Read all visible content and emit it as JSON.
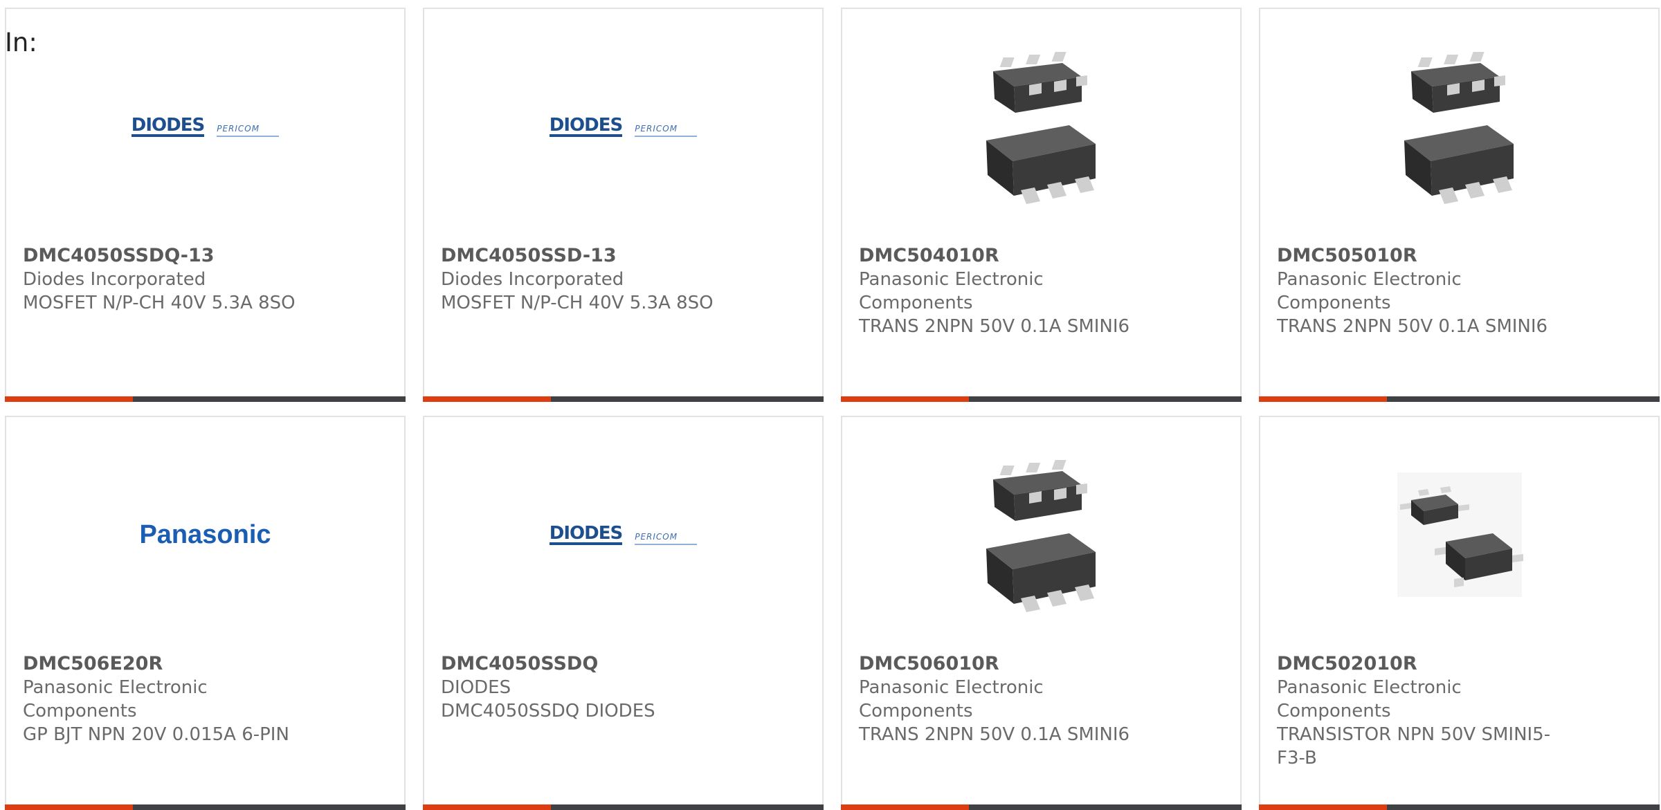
{
  "header": {
    "label": "In:"
  },
  "products": [
    {
      "part_number": "DMC4050SSDQ-13",
      "manufacturer": "Diodes Incorporated",
      "description": "MOSFET N/P-CH 40V 5.3A 8SO",
      "image": "diodes-pericom-logo"
    },
    {
      "part_number": "DMC4050SSD-13",
      "manufacturer": "Diodes Incorporated",
      "description": "MOSFET N/P-CH 40V 5.3A 8SO",
      "image": "diodes-pericom-logo"
    },
    {
      "part_number": "DMC504010R",
      "manufacturer": "Panasonic Electronic Components",
      "description": "TRANS 2NPN 50V 0.1A SMINI6",
      "image": "smini6-package"
    },
    {
      "part_number": "DMC505010R",
      "manufacturer": "Panasonic Electronic Components",
      "description": "TRANS 2NPN 50V 0.1A SMINI6",
      "image": "smini6-package"
    },
    {
      "part_number": "DMC506E20R",
      "manufacturer": "Panasonic Electronic Components",
      "description": "GP BJT NPN 20V 0.015A 6-PIN",
      "image": "panasonic-logo",
      "logo_text": "Panasonic"
    },
    {
      "part_number": "DMC4050SSDQ",
      "manufacturer": "DIODES",
      "description": "DMC4050SSDQ DIODES",
      "image": "diodes-pericom-logo"
    },
    {
      "part_number": "DMC506010R",
      "manufacturer": "Panasonic Electronic Components",
      "description": "TRANS 2NPN 50V 0.1A SMINI6",
      "image": "smini6-package"
    },
    {
      "part_number": "DMC502010R",
      "manufacturer": "Panasonic Electronic Components",
      "description": "TRANSISTOR NPN 50V SMINI5-F3-B",
      "image": "smini5-package"
    }
  ],
  "logos": {
    "diodes": "DIODES",
    "pericom": "PERICOM"
  },
  "colors": {
    "accent": "#de3d12",
    "bar_dark": "#3f4144",
    "text": "#6a6a6a",
    "border": "#e2e2e2",
    "panasonic_blue": "#1a5eb3",
    "diodes_blue": "#1d4f8f"
  }
}
